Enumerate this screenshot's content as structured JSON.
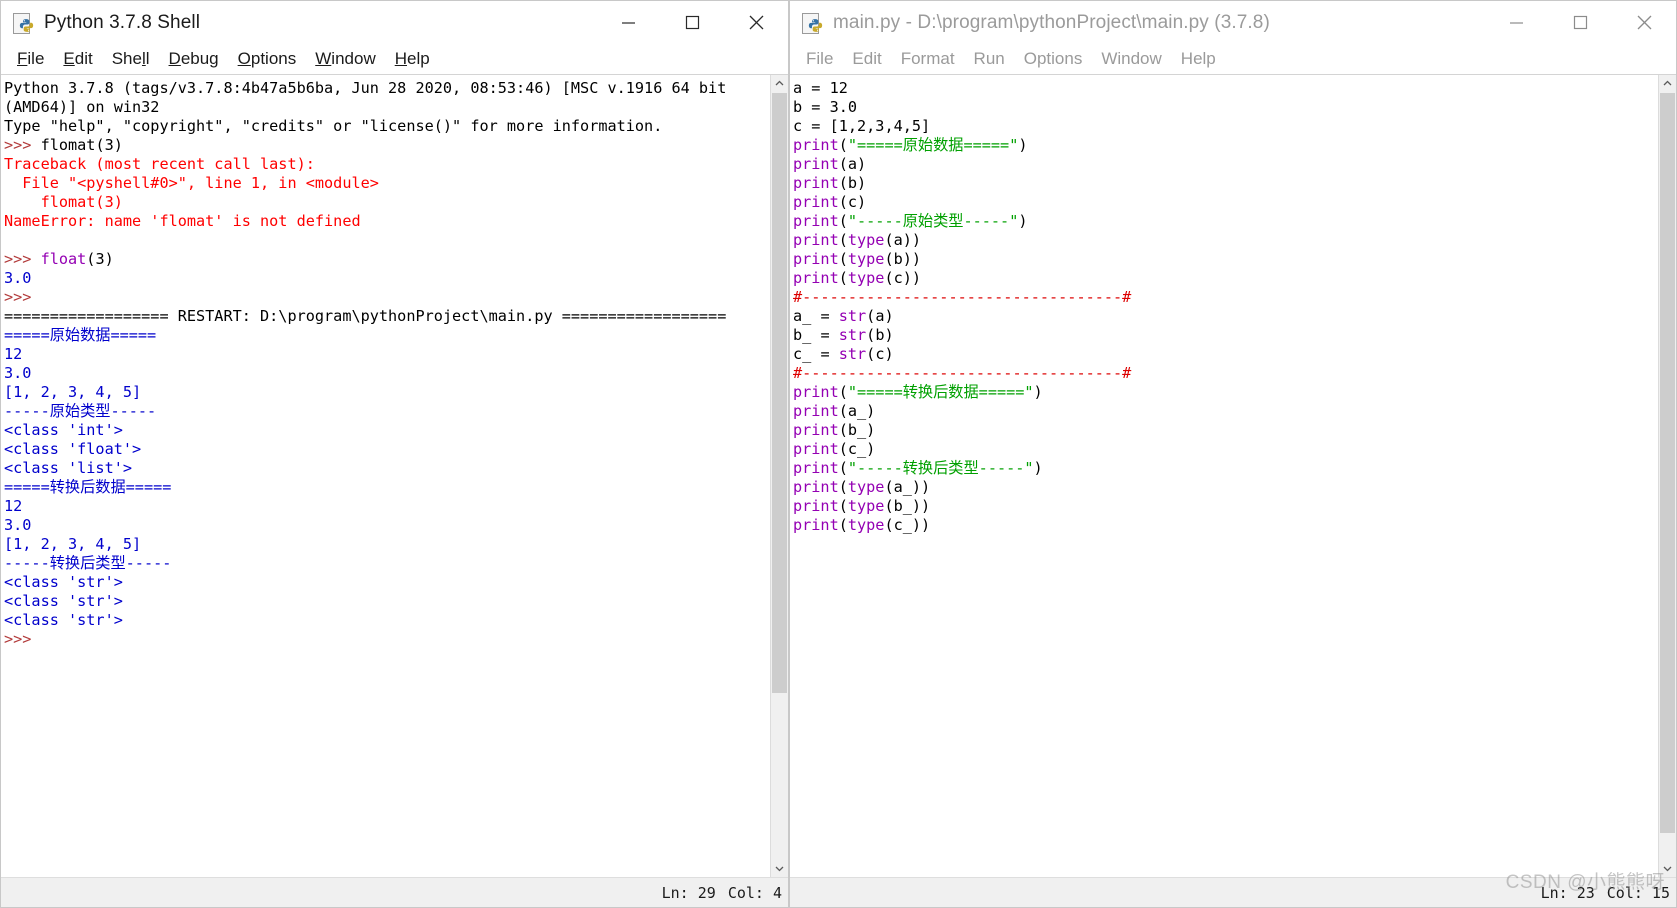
{
  "shell_window": {
    "title": "Python 3.7.8 Shell",
    "icon": "python-file-icon",
    "menu": [
      {
        "label": "File",
        "mnemonic": "F"
      },
      {
        "label": "Edit",
        "mnemonic": "E"
      },
      {
        "label": "Shell",
        "mnemonic": "l"
      },
      {
        "label": "Debug",
        "mnemonic": "D"
      },
      {
        "label": "Options",
        "mnemonic": "O"
      },
      {
        "label": "Window",
        "mnemonic": "W"
      },
      {
        "label": "Help",
        "mnemonic": "H"
      }
    ],
    "window_buttons": {
      "minimize": "minimize-icon",
      "maximize": "maximize-icon",
      "close": "close-icon"
    },
    "status": {
      "line_label": "Ln: 29",
      "col_label": "Col: 4"
    },
    "content_lines": [
      [
        {
          "t": "Python 3.7.8 (tags/v3.7.8:4b47a5b6ba, Jun 28 2020, 08:53:46) [MSC v.1916 64 bit",
          "c": "c-plain"
        }
      ],
      [
        {
          "t": "(AMD64)] on win32",
          "c": "c-plain"
        }
      ],
      [
        {
          "t": "Type \"help\", \"copyright\", \"credits\" or \"license()\" for more information.",
          "c": "c-plain"
        }
      ],
      [
        {
          "t": ">>> ",
          "c": "c-prompt"
        },
        {
          "t": "flomat(3)",
          "c": "c-plain"
        }
      ],
      [
        {
          "t": "Traceback (most recent call last):",
          "c": "c-err"
        }
      ],
      [
        {
          "t": "  File \"<pyshell#0>\", line 1, in <module>",
          "c": "c-err"
        }
      ],
      [
        {
          "t": "    flomat(3)",
          "c": "c-err"
        }
      ],
      [
        {
          "t": "NameError: name 'flomat' is not defined",
          "c": "c-err"
        }
      ],
      [
        {
          "t": "",
          "c": "c-plain"
        }
      ],
      [
        {
          "t": ">>> ",
          "c": "c-prompt"
        },
        {
          "t": "float",
          "c": "c-builtin"
        },
        {
          "t": "(3)",
          "c": "c-plain"
        }
      ],
      [
        {
          "t": "3.0",
          "c": "c-out"
        }
      ],
      [
        {
          "t": ">>> ",
          "c": "c-prompt"
        }
      ],
      [
        {
          "t": "================== RESTART: D:\\program\\pythonProject\\main.py ==================",
          "c": "c-plain"
        }
      ],
      [
        {
          "t": "=====原始数据=====",
          "c": "c-out"
        }
      ],
      [
        {
          "t": "12",
          "c": "c-out"
        }
      ],
      [
        {
          "t": "3.0",
          "c": "c-out"
        }
      ],
      [
        {
          "t": "[1, 2, 3, 4, 5]",
          "c": "c-out"
        }
      ],
      [
        {
          "t": "-----原始类型-----",
          "c": "c-out"
        }
      ],
      [
        {
          "t": "<class 'int'>",
          "c": "c-out"
        }
      ],
      [
        {
          "t": "<class 'float'>",
          "c": "c-out"
        }
      ],
      [
        {
          "t": "<class 'list'>",
          "c": "c-out"
        }
      ],
      [
        {
          "t": "=====转换后数据=====",
          "c": "c-out"
        }
      ],
      [
        {
          "t": "12",
          "c": "c-out"
        }
      ],
      [
        {
          "t": "3.0",
          "c": "c-out"
        }
      ],
      [
        {
          "t": "[1, 2, 3, 4, 5]",
          "c": "c-out"
        }
      ],
      [
        {
          "t": "-----转换后类型-----",
          "c": "c-out"
        }
      ],
      [
        {
          "t": "<class 'str'>",
          "c": "c-out"
        }
      ],
      [
        {
          "t": "<class 'str'>",
          "c": "c-out"
        }
      ],
      [
        {
          "t": "<class 'str'>",
          "c": "c-out"
        }
      ],
      [
        {
          "t": ">>> ",
          "c": "c-prompt"
        }
      ]
    ]
  },
  "editor_window": {
    "title": "main.py - D:\\program\\pythonProject\\main.py (3.7.8)",
    "icon": "python-file-icon",
    "menu": [
      {
        "label": "File"
      },
      {
        "label": "Edit"
      },
      {
        "label": "Format"
      },
      {
        "label": "Run"
      },
      {
        "label": "Options"
      },
      {
        "label": "Window"
      },
      {
        "label": "Help"
      }
    ],
    "window_buttons": {
      "minimize": "minimize-icon",
      "maximize": "maximize-icon",
      "close": "close-icon"
    },
    "status": {
      "line_label": "Ln: 23",
      "col_label": "Col: 15"
    },
    "content_lines": [
      [
        {
          "t": "a ",
          "c": "c-plain"
        },
        {
          "t": "= ",
          "c": "c-plain"
        },
        {
          "t": "12",
          "c": "c-plain"
        }
      ],
      [
        {
          "t": "b ",
          "c": "c-plain"
        },
        {
          "t": "= ",
          "c": "c-plain"
        },
        {
          "t": "3.0",
          "c": "c-plain"
        }
      ],
      [
        {
          "t": "c ",
          "c": "c-plain"
        },
        {
          "t": "= ",
          "c": "c-plain"
        },
        {
          "t": "[1,2,3,4,5]",
          "c": "c-plain"
        }
      ],
      [
        {
          "t": "print",
          "c": "c-builtin"
        },
        {
          "t": "(",
          "c": "c-plain"
        },
        {
          "t": "\"=====原始数据=====\"",
          "c": "c-string"
        },
        {
          "t": ")",
          "c": "c-plain"
        }
      ],
      [
        {
          "t": "print",
          "c": "c-builtin"
        },
        {
          "t": "(a)",
          "c": "c-plain"
        }
      ],
      [
        {
          "t": "print",
          "c": "c-builtin"
        },
        {
          "t": "(b)",
          "c": "c-plain"
        }
      ],
      [
        {
          "t": "print",
          "c": "c-builtin"
        },
        {
          "t": "(c)",
          "c": "c-plain"
        }
      ],
      [
        {
          "t": "print",
          "c": "c-builtin"
        },
        {
          "t": "(",
          "c": "c-plain"
        },
        {
          "t": "\"-----原始类型-----\"",
          "c": "c-string"
        },
        {
          "t": ")",
          "c": "c-plain"
        }
      ],
      [
        {
          "t": "print",
          "c": "c-builtin"
        },
        {
          "t": "(",
          "c": "c-plain"
        },
        {
          "t": "type",
          "c": "c-builtin"
        },
        {
          "t": "(a))",
          "c": "c-plain"
        }
      ],
      [
        {
          "t": "print",
          "c": "c-builtin"
        },
        {
          "t": "(",
          "c": "c-plain"
        },
        {
          "t": "type",
          "c": "c-builtin"
        },
        {
          "t": "(b))",
          "c": "c-plain"
        }
      ],
      [
        {
          "t": "print",
          "c": "c-builtin"
        },
        {
          "t": "(",
          "c": "c-plain"
        },
        {
          "t": "type",
          "c": "c-builtin"
        },
        {
          "t": "(c))",
          "c": "c-plain"
        }
      ],
      [
        {
          "t": "#-----------------------------------#",
          "c": "c-comment"
        }
      ],
      [
        {
          "t": "a_ ",
          "c": "c-plain"
        },
        {
          "t": "= ",
          "c": "c-plain"
        },
        {
          "t": "str",
          "c": "c-builtin"
        },
        {
          "t": "(a)",
          "c": "c-plain"
        }
      ],
      [
        {
          "t": "b_ ",
          "c": "c-plain"
        },
        {
          "t": "= ",
          "c": "c-plain"
        },
        {
          "t": "str",
          "c": "c-builtin"
        },
        {
          "t": "(b)",
          "c": "c-plain"
        }
      ],
      [
        {
          "t": "c_ ",
          "c": "c-plain"
        },
        {
          "t": "= ",
          "c": "c-plain"
        },
        {
          "t": "str",
          "c": "c-builtin"
        },
        {
          "t": "(c)",
          "c": "c-plain"
        }
      ],
      [
        {
          "t": "#-----------------------------------#",
          "c": "c-comment"
        }
      ],
      [
        {
          "t": "print",
          "c": "c-builtin"
        },
        {
          "t": "(",
          "c": "c-plain"
        },
        {
          "t": "\"=====转换后数据=====\"",
          "c": "c-string"
        },
        {
          "t": ")",
          "c": "c-plain"
        }
      ],
      [
        {
          "t": "print",
          "c": "c-builtin"
        },
        {
          "t": "(a_)",
          "c": "c-plain"
        }
      ],
      [
        {
          "t": "print",
          "c": "c-builtin"
        },
        {
          "t": "(b_)",
          "c": "c-plain"
        }
      ],
      [
        {
          "t": "print",
          "c": "c-builtin"
        },
        {
          "t": "(c_)",
          "c": "c-plain"
        }
      ],
      [
        {
          "t": "print",
          "c": "c-builtin"
        },
        {
          "t": "(",
          "c": "c-plain"
        },
        {
          "t": "\"-----转换后类型-----\"",
          "c": "c-string"
        },
        {
          "t": ")",
          "c": "c-plain"
        }
      ],
      [
        {
          "t": "print",
          "c": "c-builtin"
        },
        {
          "t": "(",
          "c": "c-plain"
        },
        {
          "t": "type",
          "c": "c-builtin"
        },
        {
          "t": "(a_))",
          "c": "c-plain"
        }
      ],
      [
        {
          "t": "print",
          "c": "c-builtin"
        },
        {
          "t": "(",
          "c": "c-plain"
        },
        {
          "t": "type",
          "c": "c-builtin"
        },
        {
          "t": "(b_))",
          "c": "c-plain"
        }
      ],
      [
        {
          "t": "print",
          "c": "c-builtin"
        },
        {
          "t": "(",
          "c": "c-plain"
        },
        {
          "t": "type",
          "c": "c-builtin"
        },
        {
          "t": "(c_))",
          "c": "c-plain"
        }
      ]
    ]
  },
  "watermark": {
    "text": "CSDN @小熊熊呀"
  },
  "colors": {
    "output_blue": "#0000cc",
    "error_red": "#ff0000",
    "string_green": "#00a000",
    "builtin_purple": "#9400b3",
    "comment_red": "#dd0000",
    "prompt_brown": "#b33c3c"
  }
}
